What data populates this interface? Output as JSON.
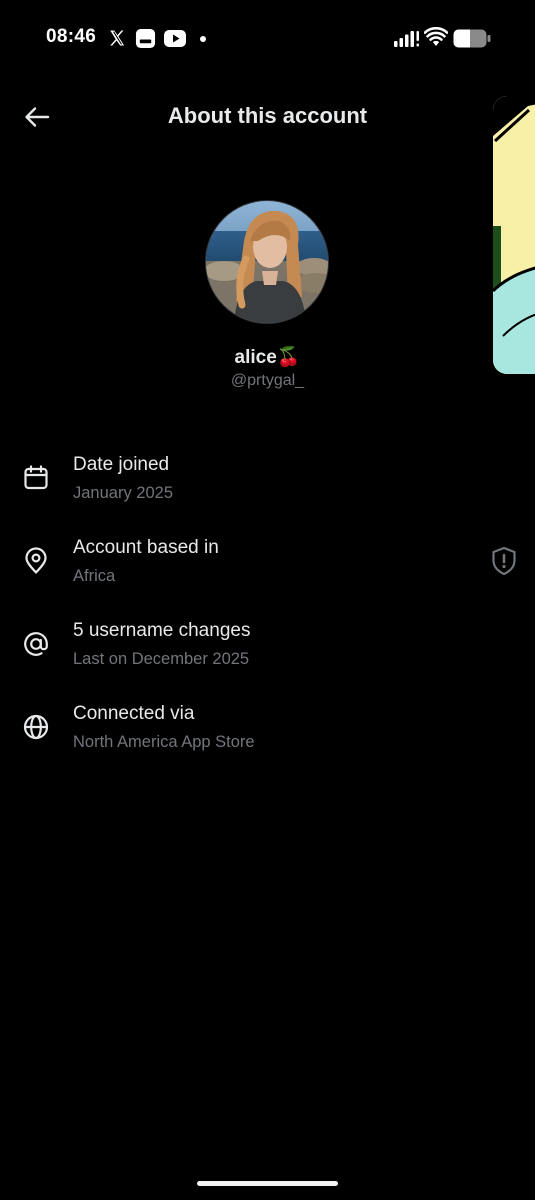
{
  "status_bar": {
    "time": "08:46",
    "app_icons": [
      "x-logo-icon",
      "messaging-app-icon",
      "youtube-icon",
      "notification-dot"
    ],
    "system_icons": [
      "signal-icon",
      "wifi-icon",
      "battery-icon"
    ]
  },
  "header": {
    "title": "About this account",
    "back_icon": "back-arrow-icon"
  },
  "profile": {
    "display_name": "alice🍒",
    "handle": "@prtygal_"
  },
  "rows": [
    {
      "icon": "calendar-icon",
      "title": "Date joined",
      "subtitle": "January 2025"
    },
    {
      "icon": "location-pin-icon",
      "title": "Account based in",
      "subtitle": "Africa",
      "trailing_icon": "shield-alert-icon"
    },
    {
      "icon": "at-sign-icon",
      "title": "5 username changes",
      "subtitle": "Last on December 2025"
    },
    {
      "icon": "globe-icon",
      "title": "Connected via",
      "subtitle": "North America App Store"
    }
  ],
  "colors": {
    "background": "#000000",
    "primary_text": "#e7e9ea",
    "secondary_text": "#71767b"
  }
}
